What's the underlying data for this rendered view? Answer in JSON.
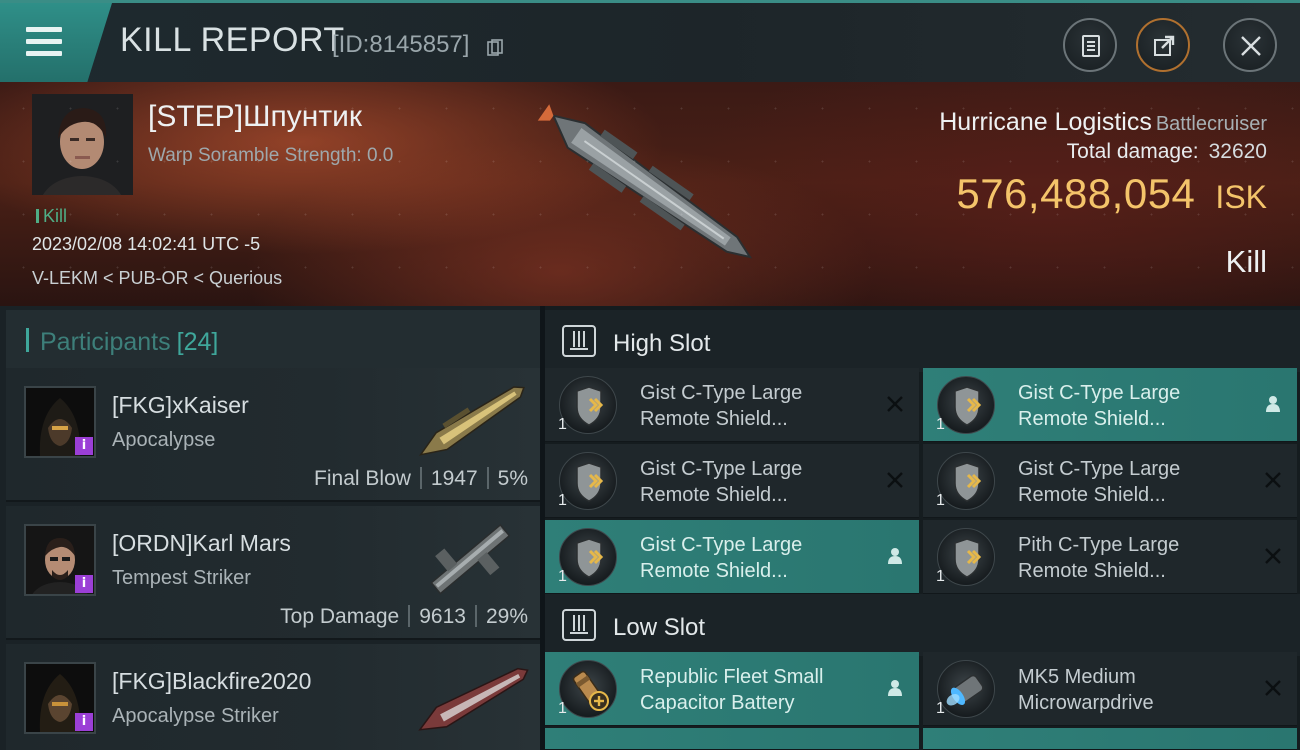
{
  "header": {
    "title": "KILL REPORT",
    "id_text": "[ID:8145857]"
  },
  "victim": {
    "name": "[STEP]Шпунтик",
    "warp_scramble": "Warp Soramble Strength: 0.0",
    "tag": "Kill",
    "datetime": "2023/02/08 14:02:41 UTC -5",
    "location": "V-LEKM < PUB-OR < Querious",
    "ship_name": "Hurricane Logistics",
    "ship_class": "Battlecruiser",
    "total_damage_label": "Total damage:",
    "total_damage": "32620",
    "isk_value": "576,488,054",
    "isk_unit": "ISK",
    "result": "Kill"
  },
  "participants": {
    "title": "Participants",
    "count": "[24]",
    "rows": [
      {
        "name": "[FKG]xKaiser",
        "ship": "Apocalypse",
        "role": "Final Blow",
        "damage": "1947",
        "percent": "5%"
      },
      {
        "name": "[ORDN]Karl Mars",
        "ship": "Tempest Striker",
        "role": "Top Damage",
        "damage": "9613",
        "percent": "29%"
      },
      {
        "name": "[FKG]Blackfire2020",
        "ship": "Apocalypse Striker"
      }
    ]
  },
  "fitting": {
    "high_slot": {
      "title": "High Slot",
      "modules": [
        {
          "line1": "Gist C-Type Large",
          "line2": "Remote Shield...",
          "qty": "1",
          "status": "destroyed",
          "icon": "shield-module-icon"
        },
        {
          "line1": "Gist C-Type Large",
          "line2": "Remote Shield...",
          "qty": "1",
          "status": "dropped",
          "icon": "shield-module-icon"
        },
        {
          "line1": "Gist C-Type Large",
          "line2": "Remote Shield...",
          "qty": "1",
          "status": "destroyed",
          "icon": "shield-module-icon"
        },
        {
          "line1": "Gist C-Type Large",
          "line2": "Remote Shield...",
          "qty": "1",
          "status": "destroyed",
          "icon": "shield-module-icon"
        },
        {
          "line1": "Gist C-Type Large",
          "line2": "Remote Shield...",
          "qty": "1",
          "status": "dropped",
          "icon": "shield-module-icon"
        },
        {
          "line1": "Pith C-Type Large",
          "line2": "Remote Shield...",
          "qty": "1",
          "status": "destroyed",
          "icon": "shield-module-icon"
        }
      ]
    },
    "low_slot": {
      "title": "Low Slot",
      "modules": [
        {
          "line1": "Republic Fleet Small",
          "line2": "Capacitor Battery",
          "qty": "1",
          "status": "dropped",
          "icon": "capacitor-battery-icon"
        },
        {
          "line1": "MK5 Medium",
          "line2": "Microwarpdrive",
          "qty": "1",
          "status": "destroyed",
          "icon": "microwarpdrive-icon"
        }
      ]
    }
  },
  "colors": {
    "accent_teal": "#2f7f78",
    "isk_gold": "#f4c46a",
    "kill_green": "#4fae86",
    "implant_purple": "#9b3fd6"
  }
}
